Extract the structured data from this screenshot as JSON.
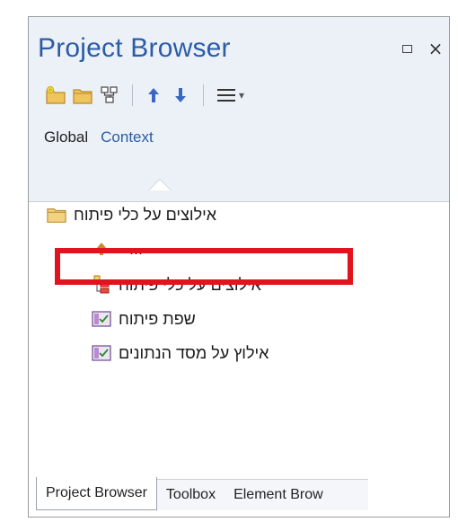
{
  "panel": {
    "title": "Project Browser",
    "maximize_icon": "maximize-icon",
    "close_label": "×"
  },
  "toolbar": {
    "icons": [
      "new-package-icon",
      "folder-icon",
      "diagram-icon",
      "move-up-icon",
      "move-down-icon",
      "menu-icon"
    ],
    "menu_caret": "▾"
  },
  "view_tabs": {
    "global": "Global",
    "context": "Context"
  },
  "tree": {
    "root_label": "אילוצים על כלי פיתוח",
    "up_label": "...",
    "package_label": "אילוצים על כלי פיתוח",
    "element1_label": "שפת פיתוח",
    "element2_label": "אילוץ על מסד הנתונים"
  },
  "bottom_tabs": {
    "project_browser": "Project Browser",
    "toolbox": "Toolbox",
    "element_browser": "Element Brow"
  },
  "colors": {
    "title": "#2a5ca8",
    "highlight": "#e0141e",
    "header_bg": "#ecf1f7",
    "arrow_blue": "#3a66c4",
    "up_arrow": "#c98a28"
  }
}
